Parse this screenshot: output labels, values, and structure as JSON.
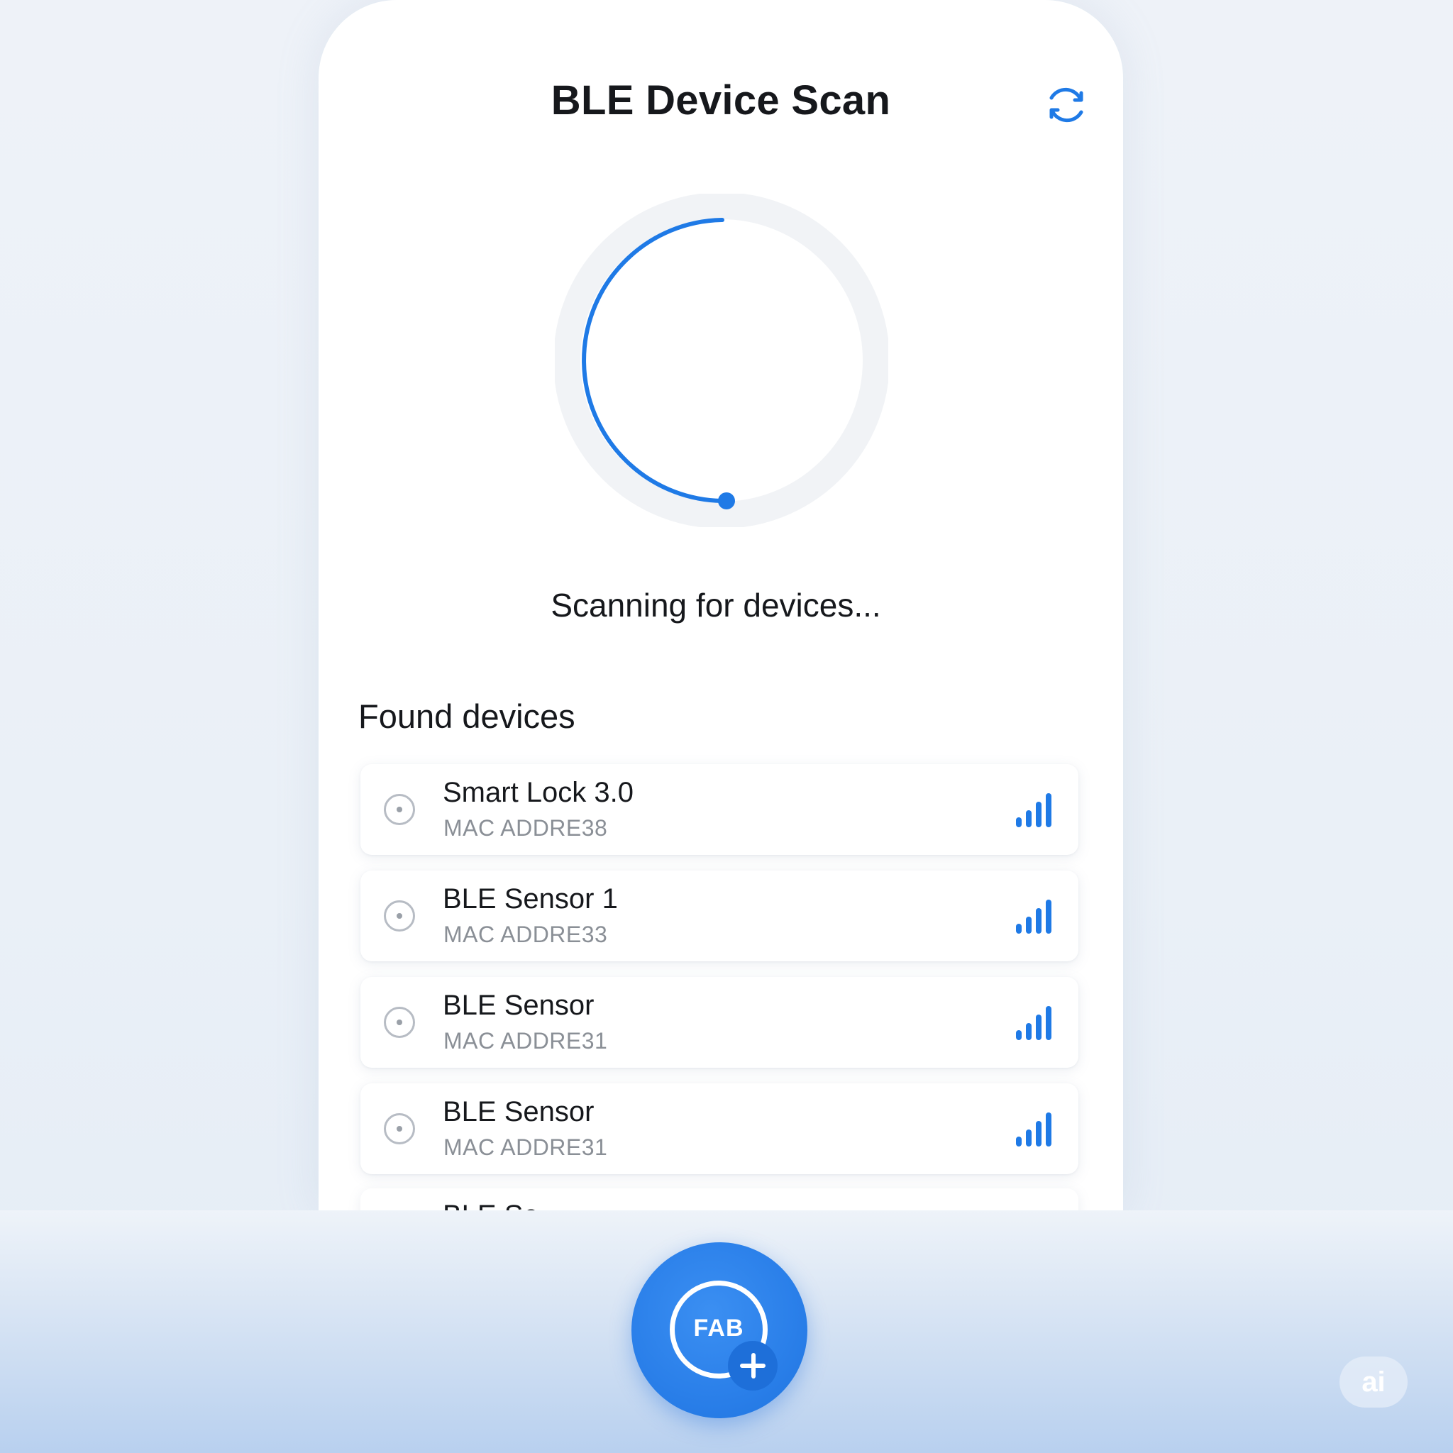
{
  "header": {
    "title": "BLE Device Scan",
    "refresh_icon": "refresh-icon"
  },
  "scan": {
    "status": "Scanning for devices...",
    "progress": 0.5,
    "accent_color": "#1f7ae6",
    "track_color": "#f1f3f6"
  },
  "devices": {
    "section_title": "Found devices",
    "items": [
      {
        "name": "Smart Lock 3.0",
        "mac": "MAC ADDRE38",
        "signal": 4
      },
      {
        "name": "BLE Sensor 1",
        "mac": "MAC ADDRE33",
        "signal": 4
      },
      {
        "name": "BLE Sensor",
        "mac": "MAC ADDRE31",
        "signal": 4
      },
      {
        "name": "BLE Sensor",
        "mac": "MAC ADDRE31",
        "signal": 4
      }
    ],
    "partial_item_name": "BLE Se..."
  },
  "fab": {
    "label": "FAB",
    "icon": "plus-icon",
    "color": "#2a7fe9"
  },
  "watermark": {
    "text": "ai"
  }
}
